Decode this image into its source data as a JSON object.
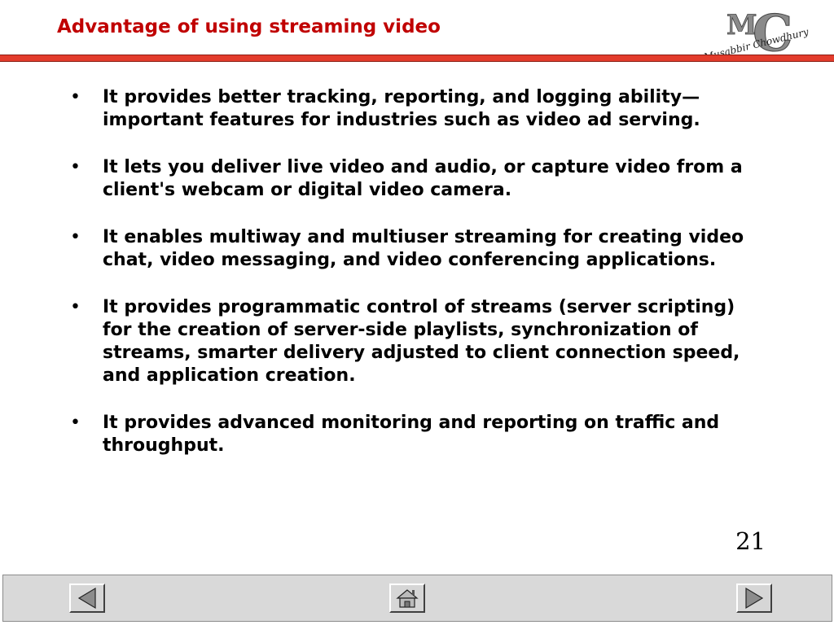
{
  "slide": {
    "title": "Advantage of using streaming video",
    "page_number": "21"
  },
  "logo": {
    "big_letters": "MC",
    "name_text": "Musabbir Chowdhury"
  },
  "bullets": [
    "It provides better tracking, reporting, and logging ability—important features for industries such as video ad serving.",
    "It lets you deliver live video and audio, or capture video from a client's webcam or digital video camera.",
    "It enables multiway and multiuser streaming for creating video chat, video messaging, and video conferencing applications.",
    "It provides programmatic control of streams (server scripting) for the creation of server-side playlists, synchronization of streams, smarter delivery adjusted to client connection speed, and application creation.",
    "It provides advanced monitoring and reporting on traffic and throughput."
  ],
  "navigation": {
    "prev_icon": "triangle-left-icon",
    "home_icon": "house-icon",
    "next_icon": "triangle-right-icon"
  }
}
